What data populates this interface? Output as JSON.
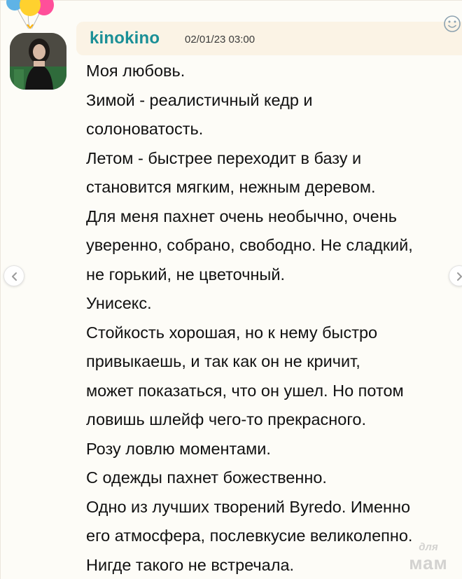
{
  "post": {
    "username": "kinokino",
    "datetime": "02/01/23 03:00",
    "lines": [
      "Моя любовь.",
      "Зимой - реалистичный кедр и",
      "солоноватость.",
      "Летом - быстрее переходит в базу и",
      "становится мягким, нежным деревом.",
      "Для меня пахнет очень необычно, очень",
      "уверенно, собрано, свободно. Не сладкий,",
      "не горький, не цветочный.",
      "Унисекс.",
      "Стойкость хорошая, но к нему быстро",
      "привыкаешь, и так как он не кричит,",
      "может показаться, что он ушел. Но потом",
      "ловишь шлейф чего-то прекрасного.",
      "Розу ловлю моментами.",
      "С одежды пахнет божественно.",
      "Одно из лучших творений Byredo. Именно",
      "его атмосфера, послевкусие великолепно.",
      "Нигде такого не встречала."
    ]
  },
  "icons": {
    "reaction": "smile-icon",
    "prev": "chevron-left-icon",
    "next": "chevron-right-icon",
    "decoration": "balloons-icon"
  },
  "watermark": {
    "top": "для",
    "main": "мам"
  },
  "colors": {
    "username": "#1a8f96",
    "header_bg": "#fbf3e5",
    "page_bg": "#fdfcf7"
  }
}
